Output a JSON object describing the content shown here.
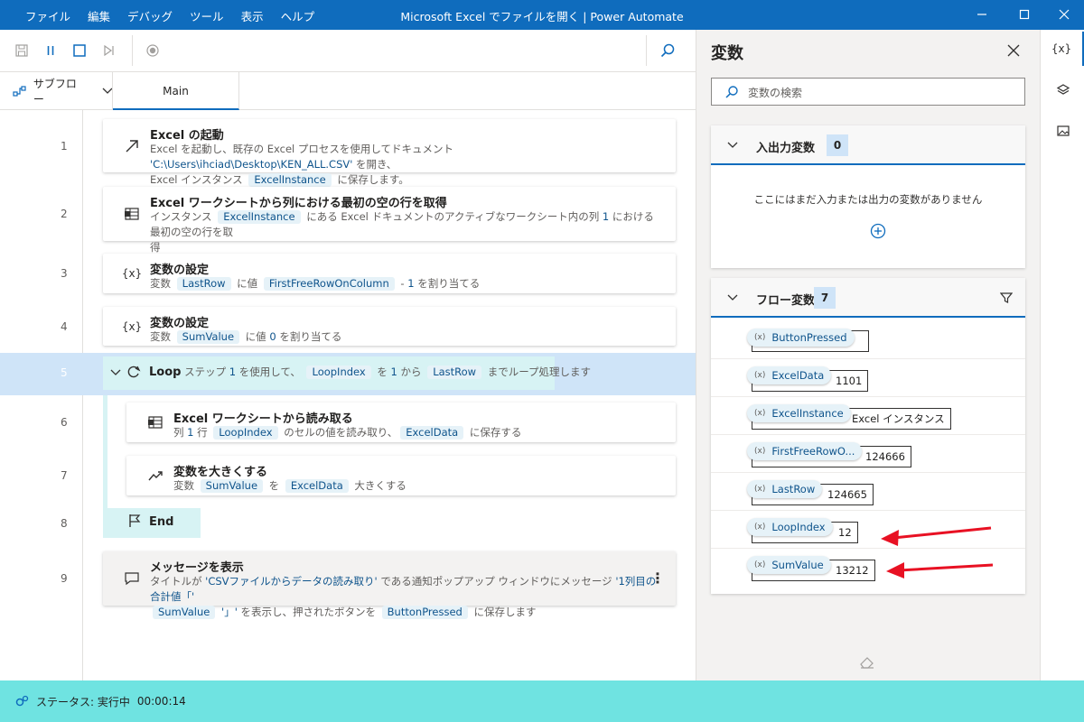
{
  "window": {
    "title": "Microsoft Excel でファイルを開く | Power Automate",
    "menu": [
      "ファイル",
      "編集",
      "デバッグ",
      "ツール",
      "表示",
      "ヘルプ"
    ]
  },
  "tabs": {
    "subflow_label": "サブフロー",
    "main_label": "Main"
  },
  "flow": {
    "actions": [
      {
        "line": "1",
        "title": "Excel の起動",
        "d1a": "Excel を起動し、既存の Excel プロセスを使用してドキュメント ",
        "d1s": "'C:\\Users\\ihciad\\Desktop\\KEN_ALL.CSV'",
        "d1b": " を開き、",
        "d2a": "Excel インスタンス ",
        "d2tok": "ExcelInstance",
        "d2b": " に保存します。"
      },
      {
        "line": "2",
        "title": "Excel ワークシートから列における最初の空の行を取得",
        "d1a": "インスタンス ",
        "d1tok": "ExcelInstance",
        "d1b": " にある Excel ドキュメントのアクティブなワークシート内の列 ",
        "d1num": "1",
        "d1c": " における最初の空の行を取",
        "d2": "得"
      },
      {
        "line": "3",
        "title": "変数の設定",
        "da": "変数 ",
        "tok1": "LastRow",
        "db": " に値 ",
        "tok2": "FirstFreeRowOnColumn",
        "dc": " - ",
        "num": "1",
        "dd": " を割り当てる"
      },
      {
        "line": "4",
        "title": "変数の設定",
        "da": "変数 ",
        "tok1": "SumValue",
        "db": " に値 ",
        "num": "0",
        "dc": " を割り当てる"
      },
      {
        "line": "5",
        "title": "Loop",
        "da": " ステップ ",
        "num1": "1",
        "db": " を使用して、 ",
        "tok1": "LoopIndex",
        "dc": " を ",
        "num2": "1",
        "dd": " から ",
        "tok2": "LastRow",
        "de": " までループ処理します"
      },
      {
        "line": "6",
        "title": "Excel ワークシートから読み取る",
        "da": "列 ",
        "num1": "1",
        "db": " 行 ",
        "tok1": "LoopIndex",
        "dc": " のセルの値を読み取り、",
        "tok2": "ExcelData",
        "dd": " に保存する"
      },
      {
        "line": "7",
        "title": "変数を大きくする",
        "da": "変数 ",
        "tok1": "SumValue",
        "db": " を ",
        "tok2": "ExcelData",
        "dc": " 大きくする"
      },
      {
        "line": "8",
        "title": "End"
      },
      {
        "line": "9",
        "title": "メッセージを表示",
        "d1a": "タイトルが ",
        "d1s": "'CSVファイルからデータの読み取り'",
        "d1b": " である通知ポップアップ ウィンドウにメッセージ ",
        "d1s2": "'1列目の合計値「'",
        "d2tok": "SumValue",
        "d2s": " '」'",
        "d2a": " を表示し、押されたボタンを ",
        "d2tok2": "ButtonPressed",
        "d2b": " に保存します"
      }
    ]
  },
  "variables_panel": {
    "title": "変数",
    "search_placeholder": "変数の検索",
    "io_section": {
      "label": "入出力変数",
      "count": "0",
      "empty_text": "ここにはまだ入力または出力の変数がありません"
    },
    "flow_section": {
      "label": "フロー変数",
      "count": "7",
      "items": [
        {
          "name": "ButtonPressed",
          "value": ""
        },
        {
          "name": "ExcelData",
          "value": "1101"
        },
        {
          "name": "ExcelInstance",
          "value": "Excel インスタンス"
        },
        {
          "name": "FirstFreeRowO...",
          "value": "124666"
        },
        {
          "name": "LastRow",
          "value": "124665"
        },
        {
          "name": "LoopIndex",
          "value": "12"
        },
        {
          "name": "SumValue",
          "value": "13212"
        }
      ]
    }
  },
  "sidebar": {
    "variables_label": "{x}"
  },
  "status": {
    "label": "ステータス: 実行中",
    "time": "00:00:14"
  },
  "colors": {
    "titlebar": "#0f6cbd",
    "status": "#6fe3e1",
    "loop_highlight": "#d7f3f4",
    "selection": "#cfe4f8",
    "arrow": "#e81123"
  }
}
